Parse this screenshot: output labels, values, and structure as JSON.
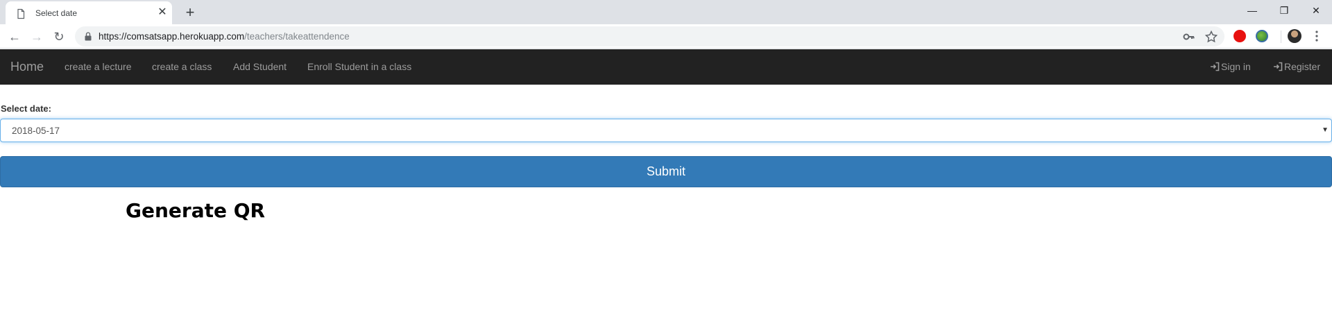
{
  "browser": {
    "tab_title": "Select date",
    "tab_close_glyph": "✕",
    "new_tab_glyph": "+",
    "url_host": "https://comsatsapp.herokuapp.com",
    "url_path": "/teachers/takeattendence",
    "window_controls": {
      "minimize": "—",
      "restore": "❐",
      "close": "✕"
    },
    "nav": {
      "back": "←",
      "forward": "→",
      "reload": "↻"
    },
    "icons": {
      "tab": "page-icon",
      "lock": "lock-icon",
      "key": "key-icon",
      "star": "star-icon",
      "extension_1": "opera-red-icon",
      "extension_2": "globe-extension-icon",
      "profile": "avatar",
      "menu": "kebab-menu-icon"
    }
  },
  "navbar": {
    "brand": "Home",
    "links": [
      "create a lecture",
      "create a class",
      "Add Student",
      "Enroll Student in a class"
    ],
    "right": {
      "sign_in": "Sign in",
      "register": "Register"
    },
    "colors": {
      "background": "#222222",
      "text": "#9d9d9d"
    }
  },
  "form": {
    "label": "Select date:",
    "date_value": "2018-05-17",
    "submit_label": "Submit",
    "colors": {
      "button": "#337ab7",
      "focus_border": "#66afe9"
    }
  },
  "heading": "Generate QR"
}
